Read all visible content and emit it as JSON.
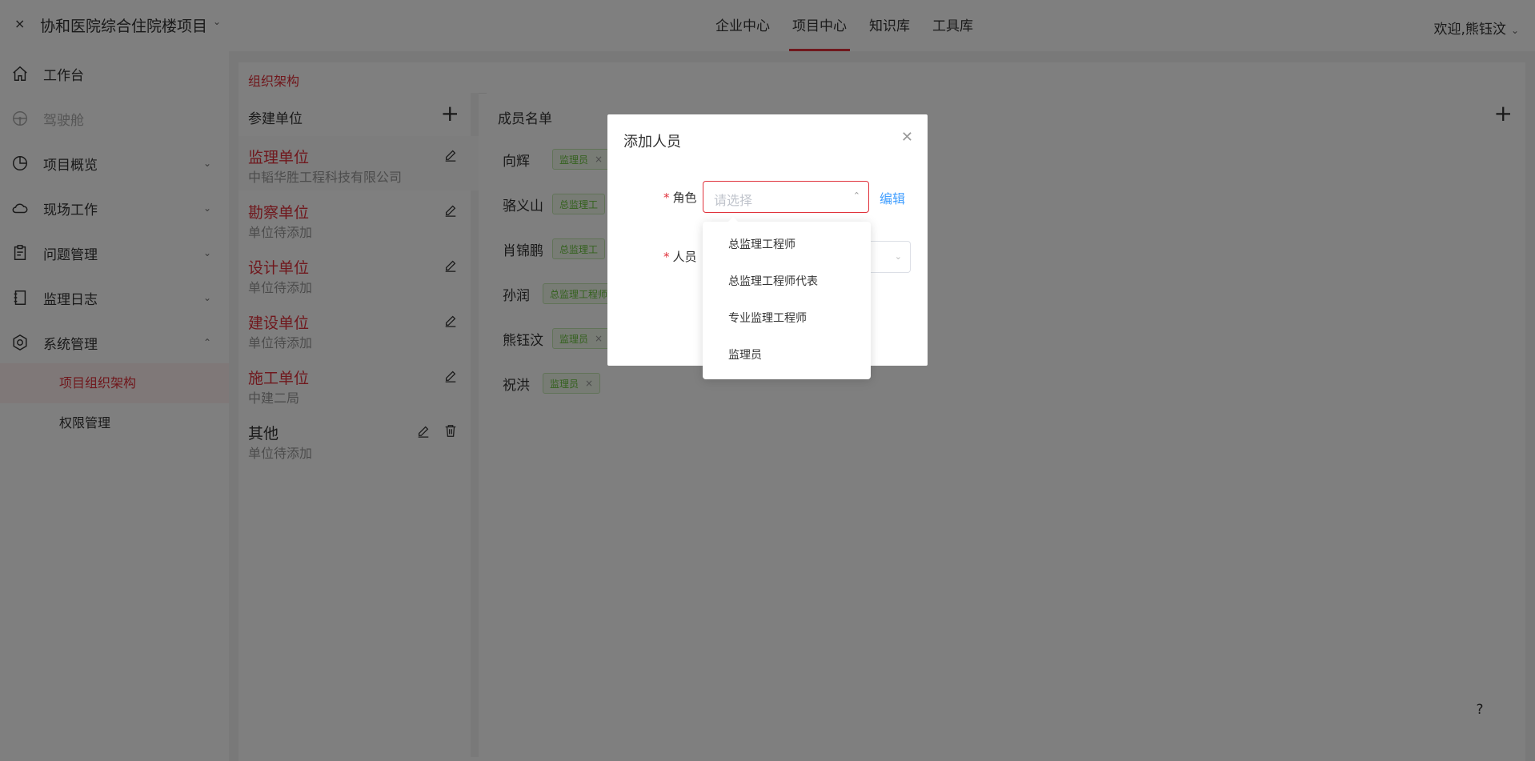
{
  "header": {
    "close_icon": "×",
    "project_title": "协和医院综合住院楼项目",
    "nav": [
      "企业中心",
      "项目中心",
      "知识库",
      "工具库"
    ],
    "active_nav": "项目中心",
    "welcome": "欢迎,熊钰汶"
  },
  "sidebar": {
    "items": [
      {
        "label": "工作台",
        "icon": "home-icon"
      },
      {
        "label": "驾驶舱",
        "icon": "steering-wheel-icon"
      },
      {
        "label": "项目概览",
        "icon": "pie-chart-icon"
      },
      {
        "label": "现场工作",
        "icon": "cloud-icon"
      },
      {
        "label": "问题管理",
        "icon": "clipboard-icon"
      },
      {
        "label": "监理日志",
        "icon": "notebook-icon"
      },
      {
        "label": "系统管理",
        "icon": "gear-icon"
      }
    ],
    "sub_items": [
      {
        "label": "项目组织架构",
        "active": true
      },
      {
        "label": "权限管理",
        "active": false
      }
    ]
  },
  "main": {
    "tab": "组织架构",
    "left_panel": {
      "title": "参建单位",
      "units": [
        {
          "name": "监理单位",
          "sub": "中韬华胜工程科技有限公司"
        },
        {
          "name": "勘察单位",
          "sub": "单位待添加"
        },
        {
          "name": "设计单位",
          "sub": "单位待添加"
        },
        {
          "name": "建设单位",
          "sub": "单位待添加"
        },
        {
          "name": "施工单位",
          "sub": "中建二局"
        },
        {
          "name": "其他",
          "sub": "单位待添加"
        }
      ]
    },
    "right_panel": {
      "title": "成员名单",
      "members": [
        {
          "name": "向辉",
          "tag": "监理员"
        },
        {
          "name": "骆义山",
          "tag": "总监理工"
        },
        {
          "name": "肖锦鹏",
          "tag": "总监理工"
        },
        {
          "name": "孙润",
          "tag": "总监理工程师"
        },
        {
          "name": "熊钰汶",
          "tag": "监理员"
        },
        {
          "name": "祝洪",
          "tag": "监理员"
        }
      ]
    }
  },
  "dialog": {
    "title": "添加人员",
    "role_label": "角色",
    "role_placeholder": "请选择",
    "edit_link": "编辑",
    "person_label": "人员",
    "dropdown_options": [
      "总监理工程师",
      "总监理工程师代表",
      "专业监理工程师",
      "监理员"
    ]
  },
  "help": "?",
  "colors": {
    "accent": "#e0313b",
    "link": "#409eff",
    "tag_green": "#67c23a"
  }
}
